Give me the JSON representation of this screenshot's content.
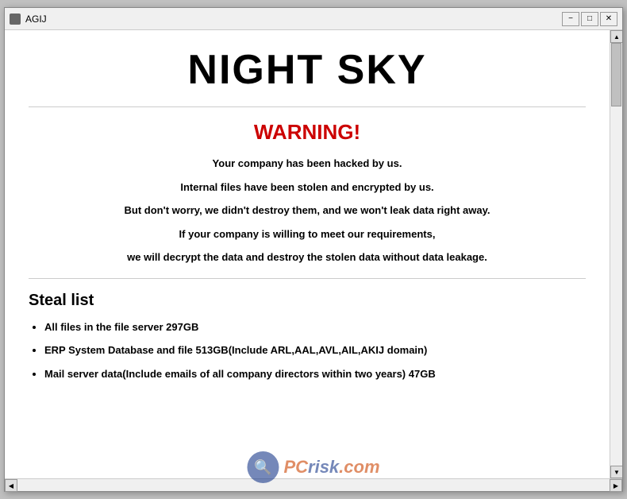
{
  "window": {
    "title": "AGIJ",
    "title_bar": {
      "minimize_label": "−",
      "maximize_label": "□",
      "close_label": "✕"
    }
  },
  "content": {
    "main_title": "NIGHT SKY",
    "warning_title": "WARNING!",
    "paragraphs": [
      "Your company has been hacked by us.",
      "Internal files have been stolen and encrypted by us.",
      "But don't worry, we didn't destroy them, and we won't leak data right away.",
      "If your company is willing to meet our requirements,",
      "we will decrypt the data and destroy the stolen data without data leakage."
    ],
    "steal_list_title": "Steal list",
    "steal_items": [
      "All files in the file server  297GB",
      "ERP System Database and file  513GB(Include ARL,AAL,AVL,AIL,AKIJ domain)",
      "Mail server data(Include emails of all company directors within two years)  47GB"
    ]
  },
  "watermark": {
    "logo_text": "🔍",
    "site_text": "risk.com"
  }
}
